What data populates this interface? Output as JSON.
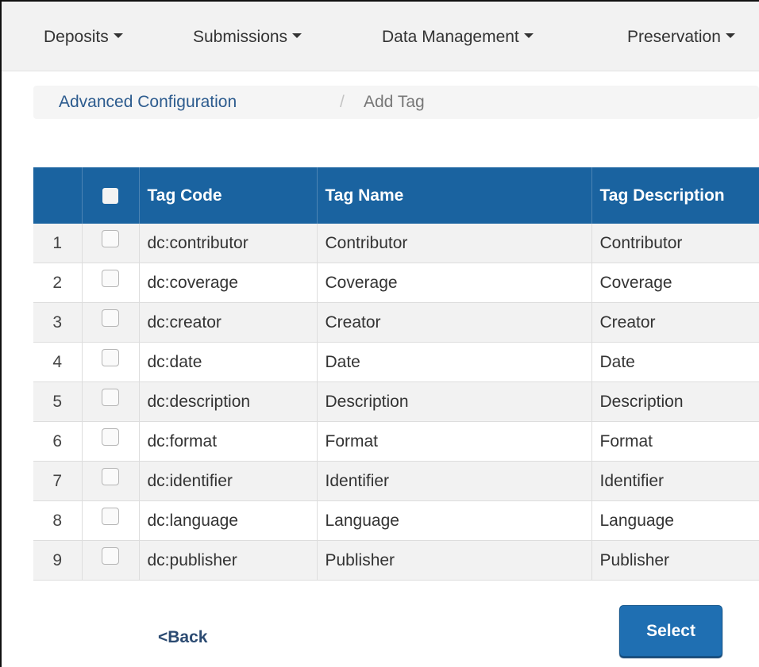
{
  "nav": {
    "items": [
      {
        "label": "Deposits"
      },
      {
        "label": "Submissions"
      },
      {
        "label": "Data Management"
      },
      {
        "label": "Preservation"
      }
    ]
  },
  "breadcrumb": {
    "parent": "Advanced Configuration",
    "separator": "/",
    "current": "Add Tag"
  },
  "table": {
    "columns": {
      "tag_code": "Tag Code",
      "tag_name": "Tag Name",
      "tag_description": "Tag Description"
    },
    "rows": [
      {
        "num": "1",
        "code": "dc:contributor",
        "name": "Contributor",
        "description": "Contributor"
      },
      {
        "num": "2",
        "code": "dc:coverage",
        "name": "Coverage",
        "description": "Coverage"
      },
      {
        "num": "3",
        "code": "dc:creator",
        "name": "Creator",
        "description": "Creator"
      },
      {
        "num": "4",
        "code": "dc:date",
        "name": "Date",
        "description": "Date"
      },
      {
        "num": "5",
        "code": "dc:description",
        "name": "Description",
        "description": "Description"
      },
      {
        "num": "6",
        "code": "dc:format",
        "name": "Format",
        "description": "Format"
      },
      {
        "num": "7",
        "code": "dc:identifier",
        "name": "Identifier",
        "description": "Identifier"
      },
      {
        "num": "8",
        "code": "dc:language",
        "name": "Language",
        "description": "Language"
      },
      {
        "num": "9",
        "code": "dc:publisher",
        "name": "Publisher",
        "description": "Publisher"
      }
    ]
  },
  "actions": {
    "back_label": "<Back",
    "select_label": "Select"
  },
  "colors": {
    "header_bg": "#1a63a0",
    "button_bg": "#1f6fb2",
    "link": "#2c5b8e"
  }
}
